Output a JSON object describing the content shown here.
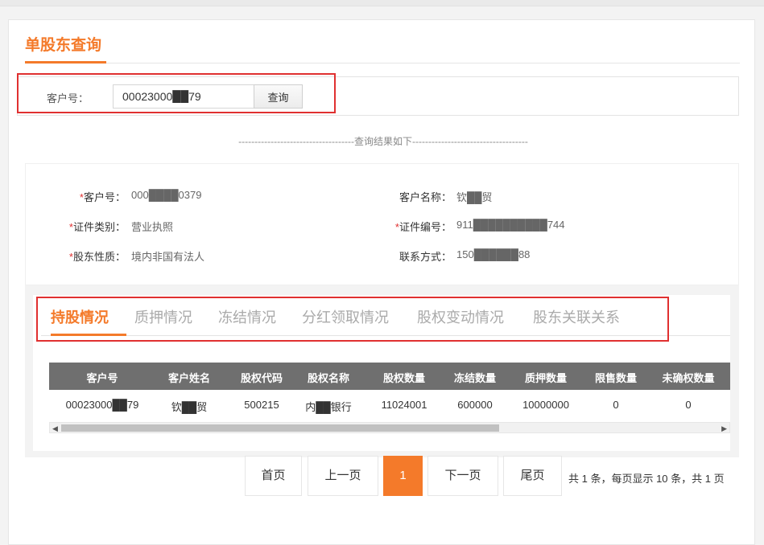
{
  "page": {
    "title": "单股东查询",
    "accent_color": "#f47a2a",
    "highlight_color": "#e03030"
  },
  "search": {
    "label": "客户号：",
    "value": "00023000██79",
    "button": "查询"
  },
  "divider_text": "------------------------------------查询结果如下------------------------------------",
  "info": {
    "customer_no": {
      "label": "客户号：",
      "required": "*",
      "value": "000████0379"
    },
    "customer_name": {
      "label": "客户名称：",
      "value": "钦██贸"
    },
    "cert_type": {
      "label": "证件类别：",
      "required": "*",
      "value": "营业执照"
    },
    "cert_no": {
      "label": "证件编号：",
      "required": "*",
      "value": "911██████████744"
    },
    "holder_nature": {
      "label": "股东性质：",
      "required": "*",
      "value": "境内非国有法人"
    },
    "contact": {
      "label": "联系方式：",
      "value": "150██████88"
    }
  },
  "tabs": [
    {
      "label": "持股情况",
      "active": true
    },
    {
      "label": "质押情况",
      "active": false
    },
    {
      "label": "冻结情况",
      "active": false
    },
    {
      "label": "分红领取情况",
      "active": false
    },
    {
      "label": "股权变动情况",
      "active": false
    },
    {
      "label": "股东关联关系",
      "active": false
    }
  ],
  "table": {
    "columns": [
      "客户号",
      "客户姓名",
      "股权代码",
      "股权名称",
      "股权数量",
      "冻结数量",
      "质押数量",
      "限售数量",
      "未确权数量"
    ],
    "rows": [
      [
        "00023000██79",
        "钦██贸",
        "500215",
        "内██银行",
        "11024001",
        "600000",
        "10000000",
        "0",
        "0"
      ]
    ]
  },
  "pagination": {
    "first": "首页",
    "prev": "上一页",
    "current": "1",
    "next": "下一页",
    "last": "尾页",
    "summary": "共 1 条，每页显示 10 条，共 1 页"
  }
}
